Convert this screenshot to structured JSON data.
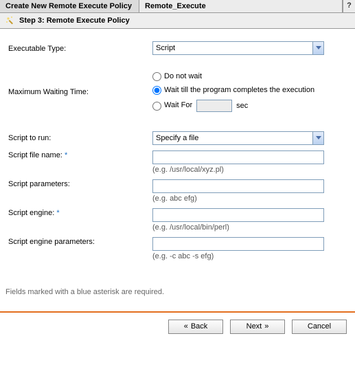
{
  "title_bar": {
    "active_tab": "Create New Remote Execute Policy",
    "secondary_tab": "Remote_Execute",
    "help": "?"
  },
  "step": {
    "title": "Step 3: Remote Execute Policy"
  },
  "executable_type": {
    "label": "Executable Type:",
    "value": "Script"
  },
  "max_wait": {
    "label": "Maximum Waiting Time:",
    "options": {
      "no_wait": "Do not wait",
      "wait_complete": "Wait till the program completes the execution",
      "wait_for": "Wait For",
      "sec": "sec"
    },
    "selected": "wait_complete",
    "wait_for_value": ""
  },
  "script_to_run": {
    "label": "Script to run:",
    "value": "Specify a file"
  },
  "script_file": {
    "label": "Script file name:",
    "required": true,
    "value": "",
    "hint": "(e.g. /usr/local/xyz.pl)"
  },
  "script_params": {
    "label": "Script parameters:",
    "value": "",
    "hint": "(e.g. abc efg)"
  },
  "script_engine": {
    "label": "Script engine:",
    "required": true,
    "value": "",
    "hint": "(e.g. /usr/local/bin/perl)"
  },
  "engine_params": {
    "label": "Script engine parameters:",
    "value": "",
    "hint": "(e.g. -c abc -s efg)"
  },
  "footnote": "Fields marked with a blue asterisk are required.",
  "buttons": {
    "back": "Back",
    "next": "Next",
    "cancel": "Cancel"
  },
  "glyphs": {
    "laquo": "«",
    "raquo": "»",
    "star": "*"
  }
}
